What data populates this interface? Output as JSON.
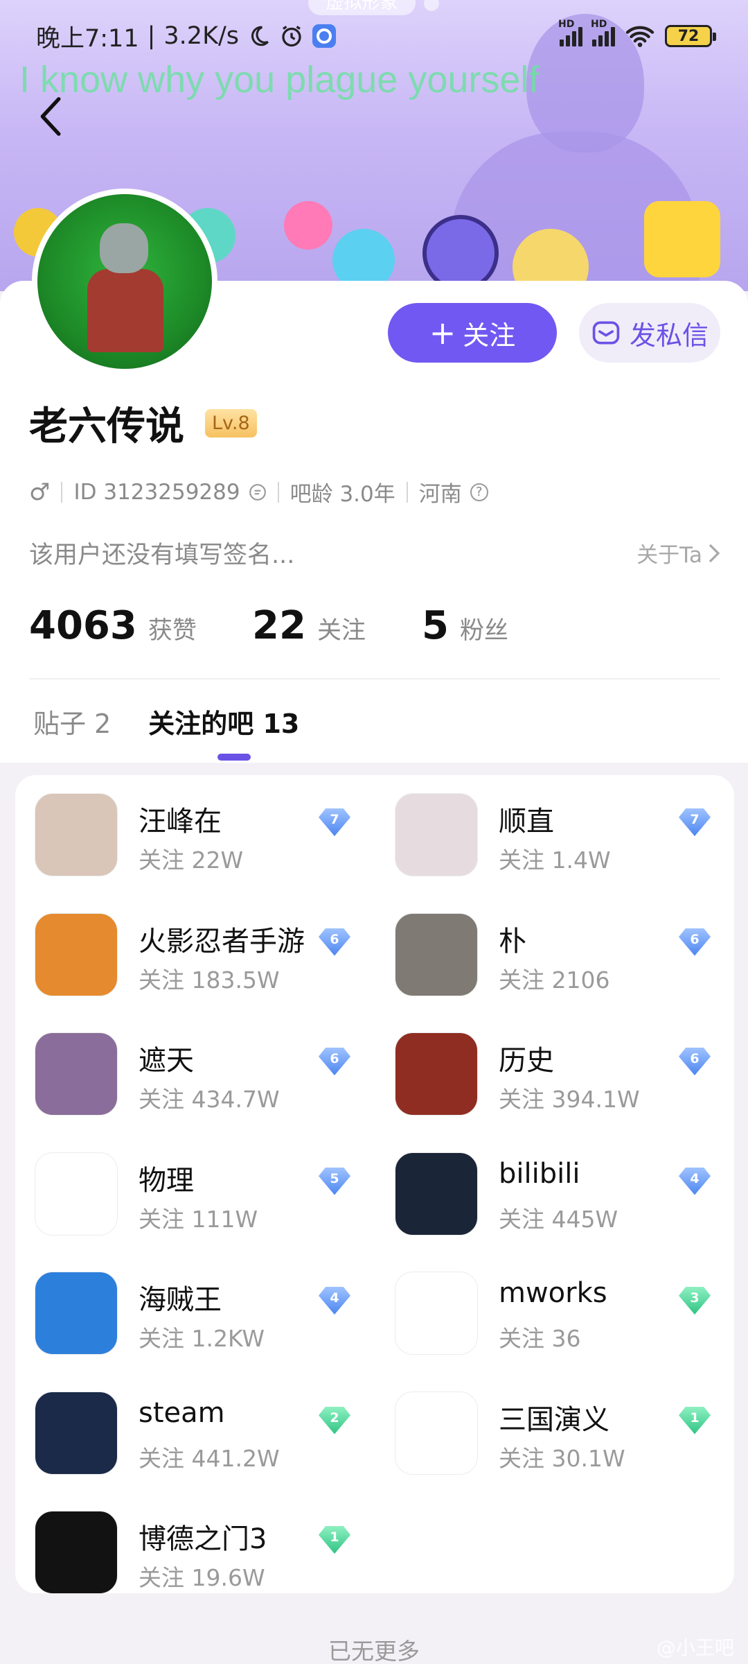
{
  "banner": {
    "tag": "虚拟形象",
    "lyric": "I know why you plague yourself"
  },
  "status_bar": {
    "time": "晚上7:11",
    "speed": "3.2K/s",
    "battery": "72",
    "hd1": "HD",
    "hd2": "HD"
  },
  "profile": {
    "follow_label": "关注",
    "message_label": "发私信",
    "name": "老六传说",
    "level": "Lv.8",
    "gender_icon": "♂",
    "id_text": "ID 3123259289",
    "bar_age": "吧龄 3.0年",
    "location": "河南",
    "signature": "该用户还没有填写签名...",
    "about": "关于Ta",
    "stats": [
      {
        "num": "4063",
        "label": "获赞"
      },
      {
        "num": "22",
        "label": "关注"
      },
      {
        "num": "5",
        "label": "粉丝"
      }
    ]
  },
  "tabs": [
    {
      "label": "贴子 2"
    },
    {
      "label": "关注的吧 13"
    }
  ],
  "bars": [
    {
      "name": "汪峰在",
      "count": "关注 22W",
      "level": "7",
      "gem": "blue",
      "logo_color": "#d9c6b8"
    },
    {
      "name": "顺直",
      "count": "关注 1.4W",
      "level": "7",
      "gem": "blue",
      "logo_color": "#e6dcdf"
    },
    {
      "name": "火影忍者手游",
      "count": "关注 183.5W",
      "level": "6",
      "gem": "blue",
      "logo_color": "#e58a2e"
    },
    {
      "name": "朴",
      "count": "关注 2106",
      "level": "6",
      "gem": "blue",
      "logo_color": "#7f7a74"
    },
    {
      "name": "遮天",
      "count": "关注 434.7W",
      "level": "6",
      "gem": "blue",
      "logo_color": "#8a6d9a"
    },
    {
      "name": "历史",
      "count": "关注 394.1W",
      "level": "6",
      "gem": "blue",
      "logo_color": "#8f2d22"
    },
    {
      "name": "物理",
      "count": "关注 111W",
      "level": "5",
      "gem": "blue",
      "logo_color": "#ffffff"
    },
    {
      "name": "bilibili",
      "count": "关注 445W",
      "level": "4",
      "gem": "blue",
      "logo_color": "#1b2538"
    },
    {
      "name": "海贼王",
      "count": "关注 1.2KW",
      "level": "4",
      "gem": "blue",
      "logo_color": "#2d7fdc"
    },
    {
      "name": "mworks",
      "count": "关注 36",
      "level": "3",
      "gem": "green",
      "logo_color": "#ffffff"
    },
    {
      "name": "steam",
      "count": "关注 441.2W",
      "level": "2",
      "gem": "green",
      "logo_color": "#1a2a48"
    },
    {
      "name": "三国演义",
      "count": "关注 30.1W",
      "level": "1",
      "gem": "green",
      "logo_color": "#ffffff"
    },
    {
      "name": "博德之门3",
      "count": "关注 19.6W",
      "level": "1",
      "gem": "green",
      "logo_color": "#121212"
    }
  ],
  "footer": {
    "no_more": "已无更多",
    "watermark": "@小王吧"
  }
}
